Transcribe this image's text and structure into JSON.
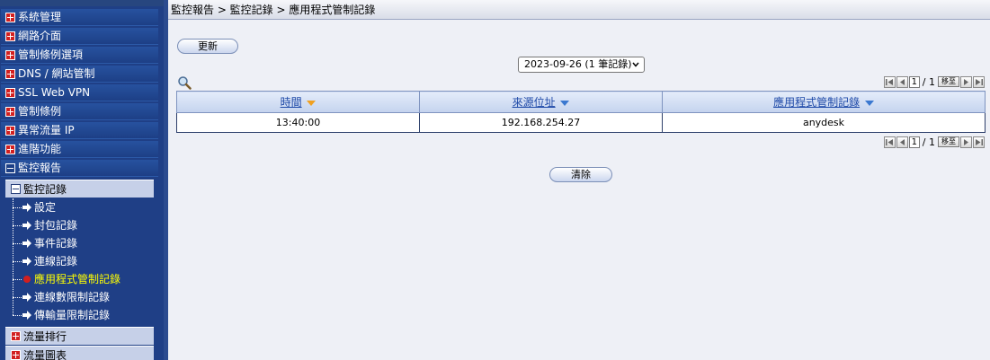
{
  "sidebar": {
    "items": [
      {
        "label": "系統管理",
        "expanded": false
      },
      {
        "label": "網路介面",
        "expanded": false
      },
      {
        "label": "管制條例選項",
        "expanded": false
      },
      {
        "label": "DNS / 網站管制",
        "expanded": false
      },
      {
        "label": "SSL Web VPN",
        "expanded": false
      },
      {
        "label": "管制條例",
        "expanded": false
      },
      {
        "label": "異常流量 IP",
        "expanded": false
      },
      {
        "label": "進階功能",
        "expanded": false
      },
      {
        "label": "監控報告",
        "expanded": true
      }
    ],
    "subitems": [
      {
        "label": "監控記錄",
        "expanded": true
      },
      {
        "label": "流量排行",
        "expanded": false
      },
      {
        "label": "流量圖表",
        "expanded": false
      }
    ],
    "leaves": [
      {
        "label": "設定",
        "active": false
      },
      {
        "label": "封包記錄",
        "active": false
      },
      {
        "label": "事件記錄",
        "active": false
      },
      {
        "label": "連線記錄",
        "active": false
      },
      {
        "label": "應用程式管制記錄",
        "active": true
      },
      {
        "label": "連線數限制記錄",
        "active": false
      },
      {
        "label": "傳輸量限制記錄",
        "active": false
      }
    ]
  },
  "header": {
    "breadcrumb": "監控報告 > 監控記錄 > 應用程式管制記錄"
  },
  "toolbar": {
    "refresh_label": "更新",
    "clear_label": "清除",
    "date_selected": "2023-09-26 (1 筆記錄)"
  },
  "pager": {
    "current_page": "1",
    "total_text": "/ 1",
    "go_label": "移至"
  },
  "table": {
    "columns": [
      "時間",
      "來源位址",
      "應用程式管制記錄"
    ],
    "rows": [
      [
        "13:40:00",
        "192.168.254.27",
        "anydesk"
      ]
    ]
  },
  "colors": {
    "sidebar_bg": "#1f3f86",
    "active_text": "#ffff00",
    "header_link": "#1f4aa8",
    "sort_arrow": "#f0a020"
  }
}
